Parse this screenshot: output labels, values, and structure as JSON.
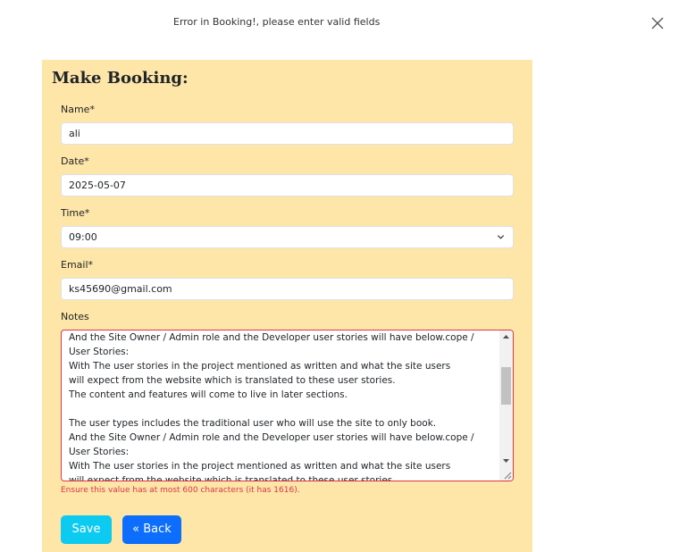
{
  "toast": {
    "message": "Error in Booking!, please enter valid fields",
    "close_icon": "close-icon"
  },
  "form": {
    "title": "Make Booking:",
    "name": {
      "label": "Name*",
      "value": "ali"
    },
    "date": {
      "label": "Date*",
      "value": "2025-05-07"
    },
    "time": {
      "label": "Time*",
      "value": "09:00",
      "icon": "chevron-down-icon"
    },
    "email": {
      "label": "Email*",
      "value": "ks45690@gmail.com"
    },
    "notes": {
      "label": "Notes",
      "visible_text": "And the Site Owner / Admin role and the Developer user stories will have below.cope /\nUser Stories:\nWith The user stories in the project mentioned as written and what the site users\nwill expect from the website which is translated to these user stories.\nThe content and features will come to live in later sections.\n\nThe user types includes the traditional user who will use the site to only book.\nAnd the Site Owner / Admin role and the Developer user stories will have below.cope /\nUser Stories:\nWith The user stories in the project mentioned as written and what the site users\nwill expect from the website which is translated to these user stories.",
      "error": "Ensure this value has at most 600 characters (it has 1616)."
    },
    "buttons": {
      "save_label": "Save",
      "back_label": "« Back"
    }
  },
  "colors": {
    "card_background": "#fee5a8",
    "error": "#dc3545",
    "save_button": "#0dcaf0",
    "back_button": "#0d6efd"
  }
}
